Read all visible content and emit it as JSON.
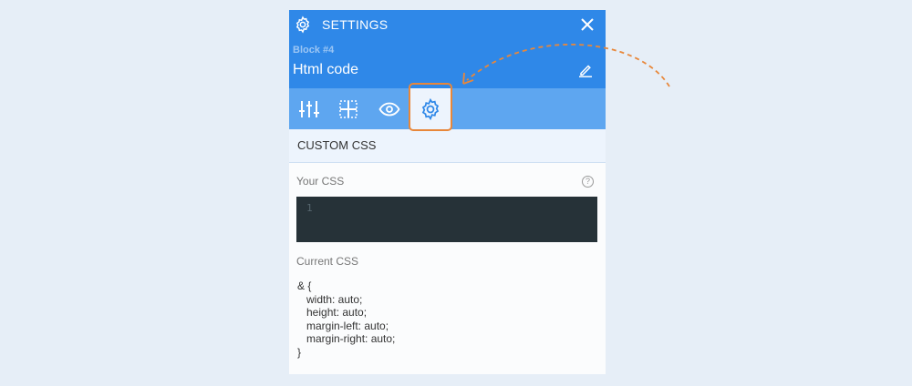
{
  "header": {
    "title": "SETTINGS",
    "block_id": "Block #4",
    "block_name": "Html code"
  },
  "tabs": [
    {
      "name": "sliders-icon"
    },
    {
      "name": "layout-grid-icon"
    },
    {
      "name": "eye-icon"
    },
    {
      "name": "gear-icon",
      "active": true
    }
  ],
  "section": {
    "title": "CUSTOM CSS"
  },
  "your_css": {
    "label": "Your CSS",
    "help": "?",
    "line_number": "1"
  },
  "current_css": {
    "label": "Current CSS",
    "code": "& {\n   width: auto;\n   height: auto;\n   margin-left: auto;\n   margin-right: auto;\n}"
  },
  "colors": {
    "header": "#2f88e8",
    "tabbar": "#5ea6f0",
    "highlight": "#e8873a",
    "editor_bg": "#263238"
  }
}
